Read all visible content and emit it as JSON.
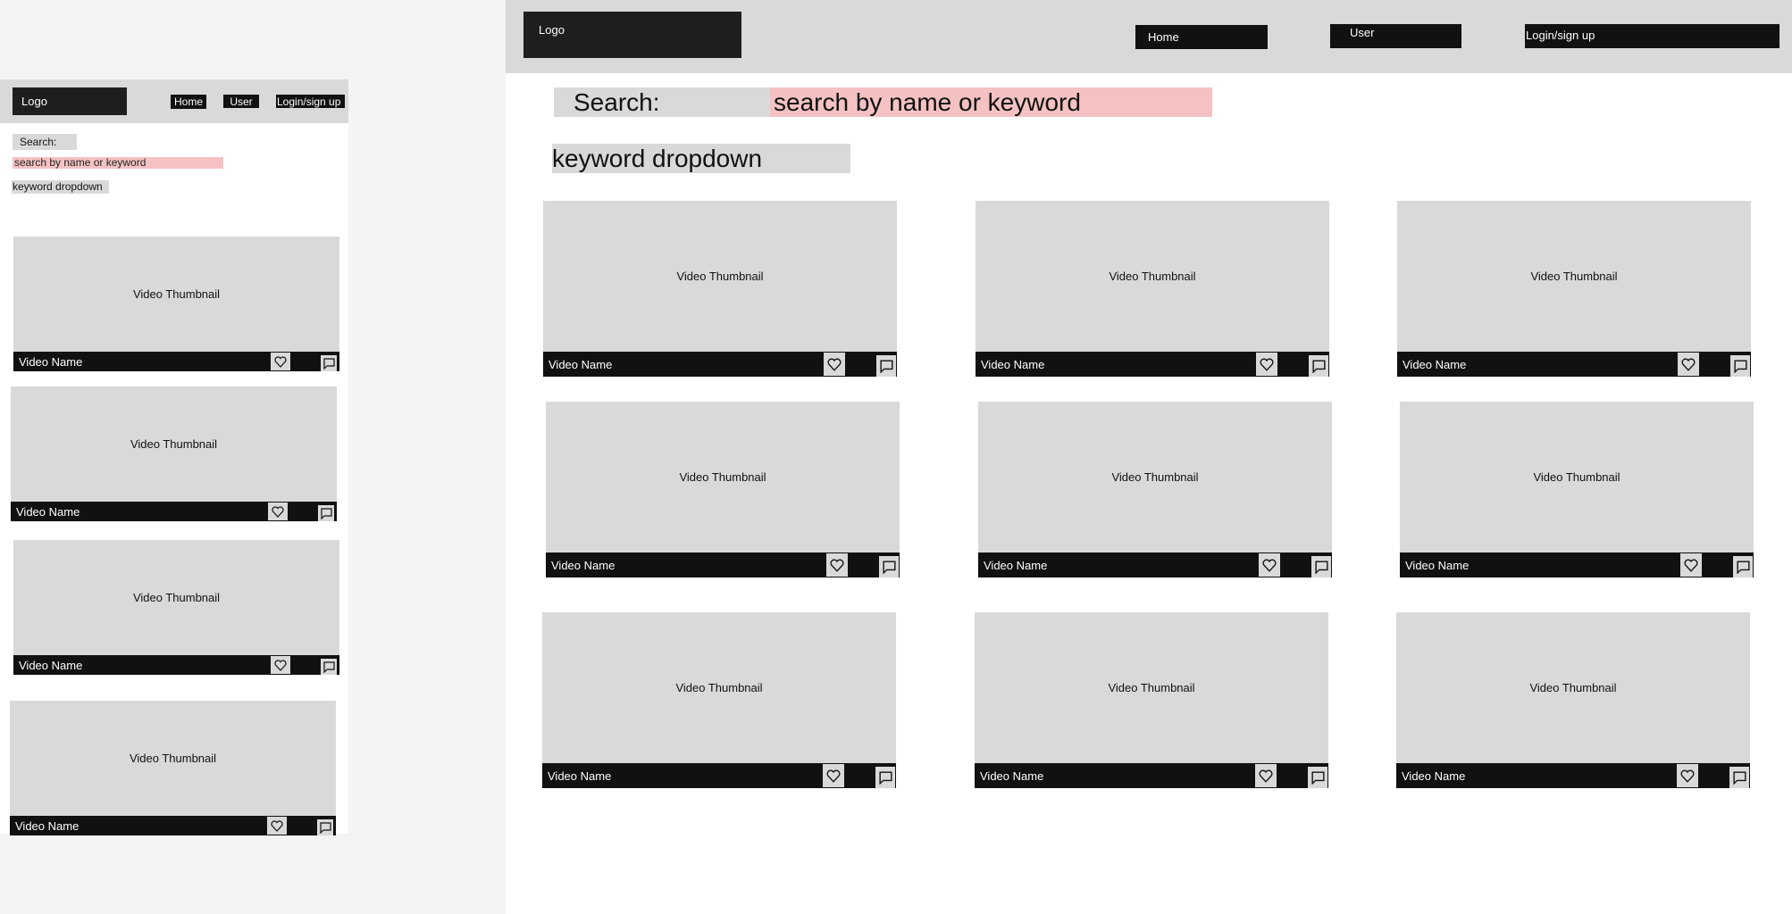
{
  "mobile": {
    "logo": "Logo",
    "nav": {
      "home": "Home",
      "user": "User",
      "login": "Login/sign up"
    },
    "search_label": "Search:",
    "search_placeholder": "search by name or keyword",
    "dropdown": "keyword dropdown",
    "videos": [
      {
        "thumbnail": "Video Thumbnail",
        "name": "Video Name"
      },
      {
        "thumbnail": "Video Thumbnail",
        "name": "Video Name"
      },
      {
        "thumbnail": "Video Thumbnail",
        "name": "Video Name"
      },
      {
        "thumbnail": "Video Thumbnail",
        "name": "Video Name"
      }
    ]
  },
  "desktop": {
    "logo": "Logo",
    "nav": {
      "home": "Home",
      "user": "User",
      "login": "Login/sign up"
    },
    "search_label": "Search:",
    "search_placeholder": "search by name or keyword",
    "dropdown": "keyword dropdown",
    "videos": [
      {
        "thumbnail": "Video Thumbnail",
        "name": "Video Name"
      },
      {
        "thumbnail": "Video Thumbnail",
        "name": "Video Name"
      },
      {
        "thumbnail": "Video Thumbnail",
        "name": "Video Name"
      },
      {
        "thumbnail": "Video Thumbnail",
        "name": "Video Name"
      },
      {
        "thumbnail": "Video Thumbnail",
        "name": "Video Name"
      },
      {
        "thumbnail": "Video Thumbnail",
        "name": "Video Name"
      },
      {
        "thumbnail": "Video Thumbnail",
        "name": "Video Name"
      },
      {
        "thumbnail": "Video Thumbnail",
        "name": "Video Name"
      },
      {
        "thumbnail": "Video Thumbnail",
        "name": "Video Name"
      }
    ]
  },
  "icons": {
    "like": "heart-icon",
    "comment": "comment-icon"
  },
  "colors": {
    "header": "#d9d9d9",
    "dark": "#111111",
    "search_field": "#f4c2c2",
    "background": "#f4f4f4"
  }
}
